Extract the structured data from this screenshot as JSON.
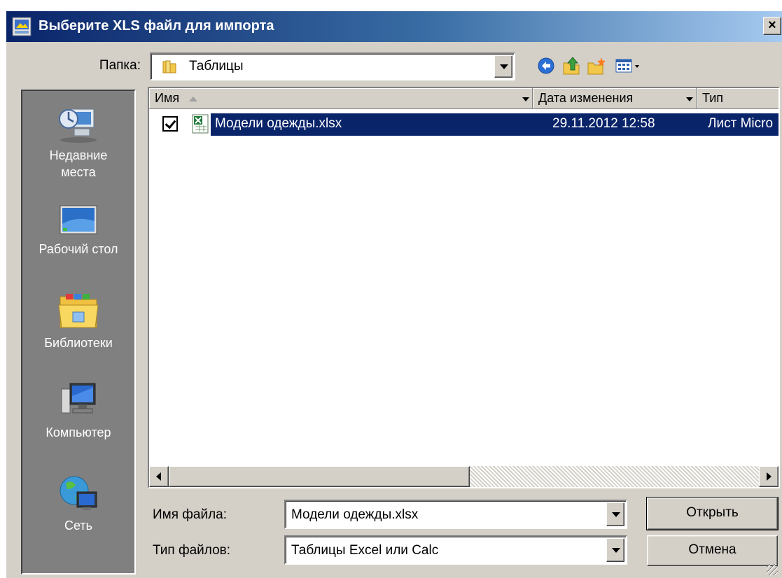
{
  "window": {
    "title": "Выберите XLS файл для импорта",
    "close_label": "×"
  },
  "folder": {
    "label": "Папка:",
    "value": "Таблицы"
  },
  "places": [
    {
      "label": "Недавние",
      "label2": "места",
      "icon": "recent-places-icon"
    },
    {
      "label": "Рабочий стол",
      "icon": "desktop-icon"
    },
    {
      "label": "Библиотеки",
      "icon": "libraries-icon"
    },
    {
      "label": "Компьютер",
      "icon": "computer-icon"
    },
    {
      "label": "Сеть",
      "icon": "network-icon"
    }
  ],
  "columns": {
    "name": "Имя",
    "date": "Дата изменения",
    "type": "Тип"
  },
  "files": [
    {
      "name": "Модели одежды.xlsx",
      "date": "29.11.2012 12:58",
      "type": "Лист Micro",
      "checked": true,
      "icon": "excel-file-icon"
    }
  ],
  "bottom": {
    "filename_label": "Имя файла:",
    "filename_value": "Модели одежды.xlsx",
    "filetype_label": "Тип файлов:",
    "filetype_value": "Таблицы Excel или Calc",
    "open_label": "Открыть",
    "cancel_label": "Отмена"
  },
  "colors": {
    "title_bar": "#0a246a",
    "selection": "#0a246a",
    "dialog_bg": "#d4d0c8",
    "places_bg": "#808080"
  }
}
